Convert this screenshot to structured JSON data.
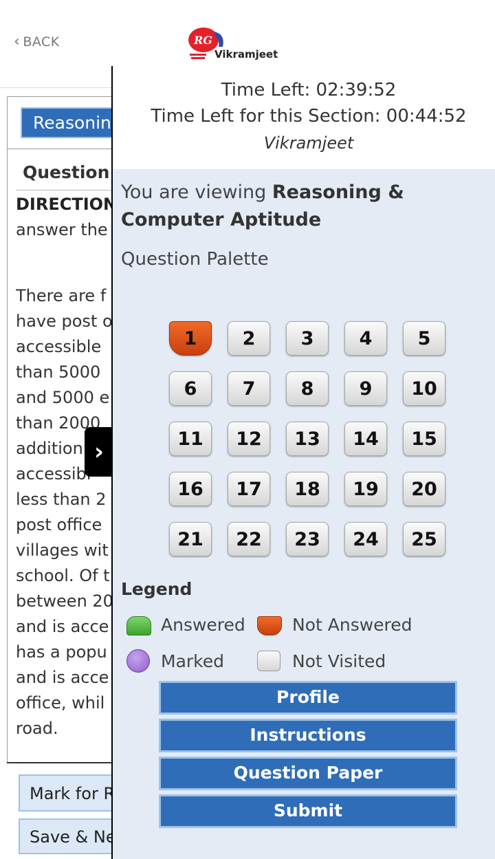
{
  "header": {
    "back_label": "BACK",
    "logo_mark": "RG",
    "logo_text": "Vikramjeet"
  },
  "question_panel": {
    "section_tab": "Reasoning & Computer Aptitude",
    "question_number_label": "Question N",
    "directions_title": "DIRECTION",
    "directions_text": "answer the",
    "paragraph_lines": [
      "There are f",
      "have post o",
      "accessible",
      "than 5000",
      "and 5000 e",
      "than 2000",
      "addition",
      "accessibl",
      "less than 2",
      "post office",
      "villages wit",
      "school. Of t",
      "between 20",
      "and is acce",
      "has a popu",
      "and is acce",
      "office, whil",
      "road."
    ],
    "mark_review_label": "Mark for Review & Next",
    "save_next_label": "Save & Next"
  },
  "drawer": {
    "time_left": "Time Left: 02:39:52",
    "section_time_left": "Time Left for this Section: 00:44:52",
    "candidate_name": "Vikramjeet",
    "viewing_prefix": "You are viewing",
    "viewing_section": "Reasoning & Computer Aptitude",
    "palette_title": "Question Palette",
    "questions": [
      "1",
      "2",
      "3",
      "4",
      "5",
      "6",
      "7",
      "8",
      "9",
      "10",
      "11",
      "12",
      "13",
      "14",
      "15",
      "16",
      "17",
      "18",
      "19",
      "20",
      "21",
      "22",
      "23",
      "24",
      "25"
    ],
    "current_question": "1",
    "legend": {
      "title": "Legend",
      "answered": "Answered",
      "not_answered": "Not Answered",
      "marked": "Marked",
      "not_visited": "Not Visited"
    },
    "buttons": {
      "profile": "Profile",
      "instructions": "Instructions",
      "question_paper": "Question Paper",
      "submit": "Submit"
    }
  },
  "colors": {
    "primary_blue": "#2f6db8",
    "drawer_bg": "#e4ebf5",
    "not_answered": "#d9501a",
    "answered": "#4cb33a",
    "marked": "#a77adc"
  },
  "icons": {
    "back": "chevron-left-icon",
    "toggle": "chevron-right-icon"
  }
}
